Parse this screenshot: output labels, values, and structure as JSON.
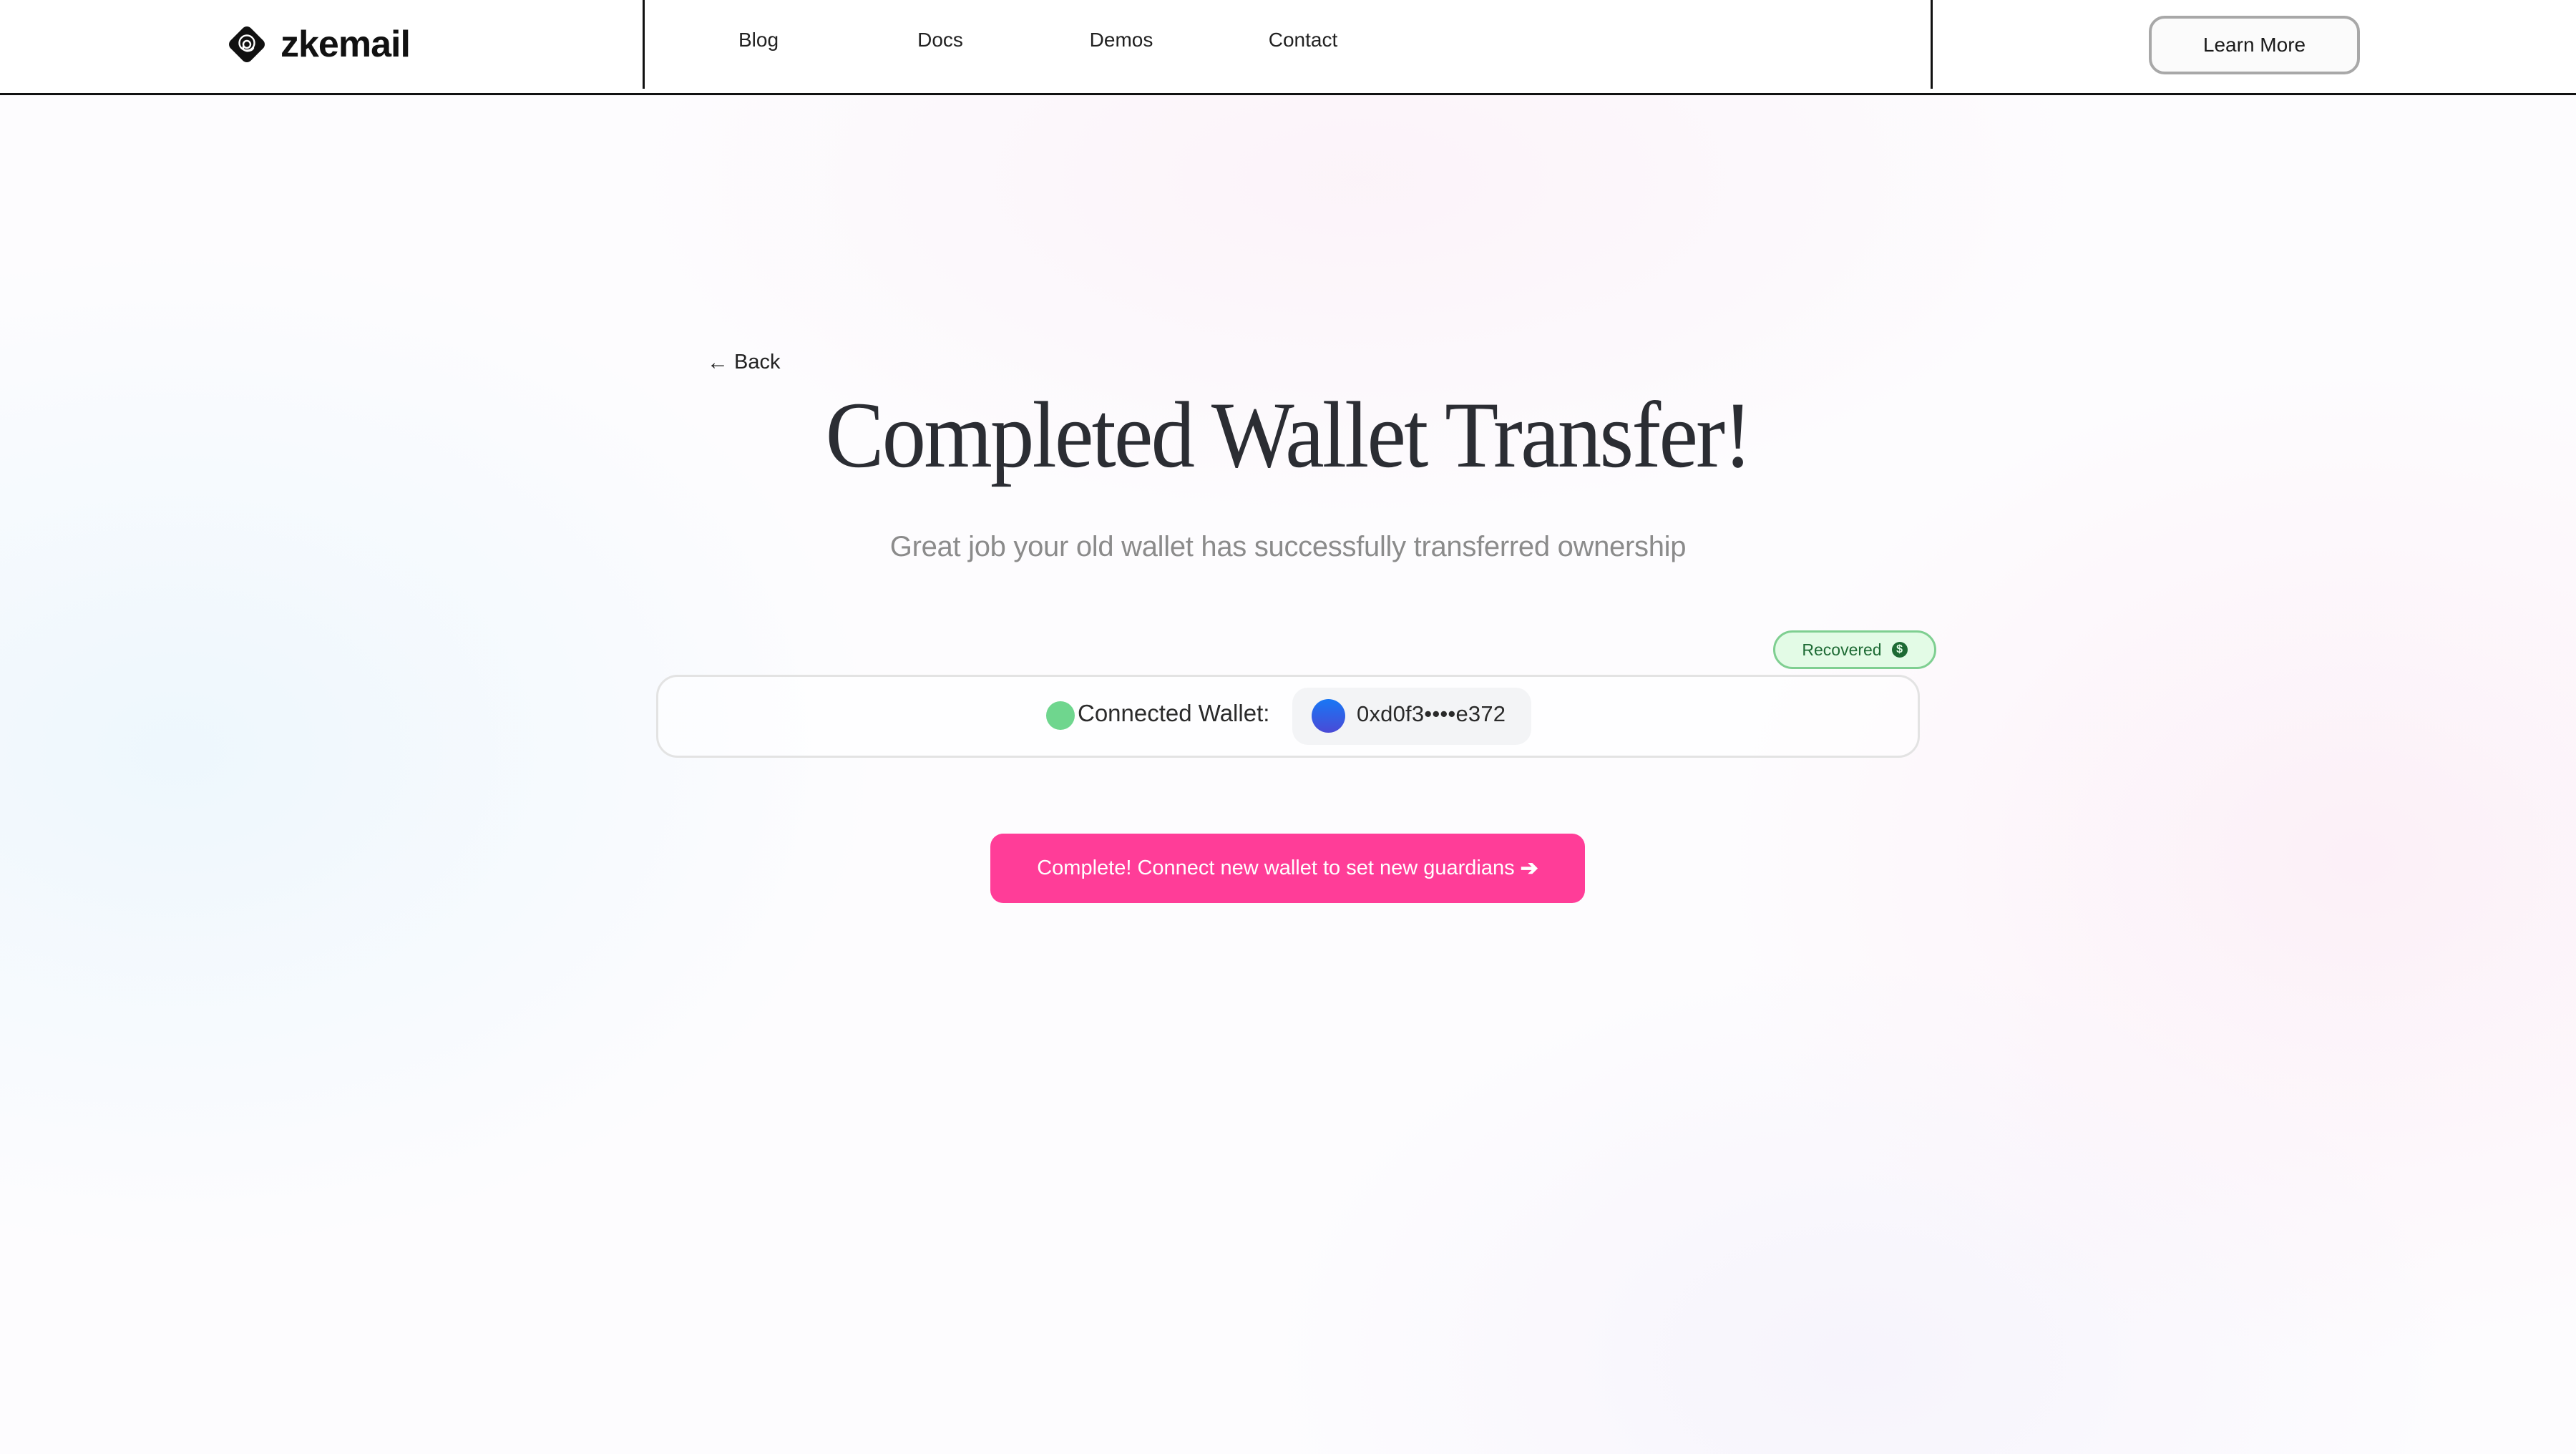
{
  "header": {
    "logo_text": "zkemail",
    "nav": [
      {
        "label": "Blog"
      },
      {
        "label": "Docs"
      },
      {
        "label": "Demos"
      },
      {
        "label": "Contact"
      }
    ],
    "learn_more_label": "Learn More"
  },
  "main": {
    "back_label": "Back",
    "back_icon": "arrow-left-icon",
    "title": "Completed Wallet Transfer!",
    "subtitle": "Great job your old wallet has successfully transferred ownership",
    "status_badge": {
      "label": "Recovered",
      "icon": "dollar-circle-icon",
      "icon_glyph": "$"
    },
    "wallet": {
      "label": "Connected Wallet:",
      "status_color": "#6fd68e",
      "address": "0xd0f3••••e372"
    },
    "cta": {
      "label": "Complete! Connect new wallet to set new guardians",
      "arrow": "➔"
    }
  },
  "colors": {
    "accent_pink": "#ff3d98",
    "badge_green_bg": "#e3fbe6",
    "badge_green_text": "#1d6a34",
    "subtitle_gray": "#8b8b8b"
  }
}
